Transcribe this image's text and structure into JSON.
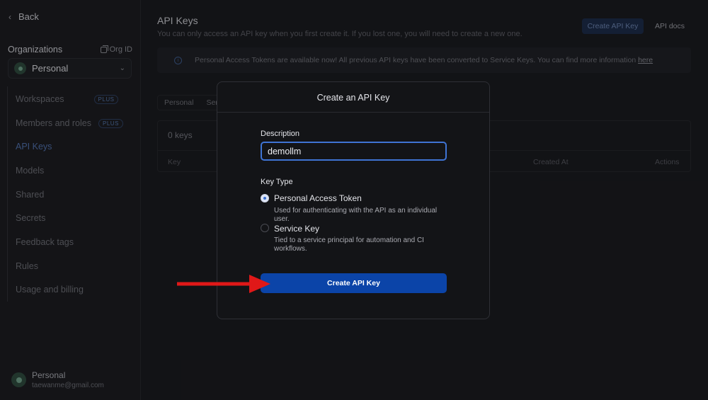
{
  "sidebar": {
    "back_label": "Back",
    "org_label": "Organizations",
    "org_id_label": "Org ID",
    "org_selected": "Personal",
    "items": [
      {
        "label": "Workspaces",
        "badge": "PLUS"
      },
      {
        "label": "Members and roles",
        "badge": "PLUS"
      },
      {
        "label": "API Keys",
        "badge": ""
      },
      {
        "label": "Models",
        "badge": ""
      },
      {
        "label": "Shared",
        "badge": ""
      },
      {
        "label": "Secrets",
        "badge": ""
      },
      {
        "label": "Feedback tags",
        "badge": ""
      },
      {
        "label": "Rules",
        "badge": ""
      },
      {
        "label": "Usage and billing",
        "badge": ""
      }
    ],
    "user": {
      "name": "Personal",
      "email": "taewanme@gmail.com"
    }
  },
  "main": {
    "title": "API Keys",
    "subtitle": "You can only access an API key when you first create it. If you lost one, you will need to create a new one.",
    "create_button": "Create API Key",
    "docs_button": "API docs",
    "banner_text": "Personal Access Tokens are available now! All previous API keys have been converted to Service Keys. You can find more information",
    "banner_link": "here",
    "tabs": [
      "Personal",
      "Serv"
    ],
    "key_count": "0 keys",
    "columns": {
      "key": "Key",
      "created_at": "Created At",
      "actions": "Actions"
    }
  },
  "modal": {
    "title": "Create an API Key",
    "description_label": "Description",
    "description_value": "demollm",
    "key_type_label": "Key Type",
    "options": [
      {
        "title": "Personal Access Token",
        "desc": "Used for authenticating with the API as an individual user.",
        "selected": true
      },
      {
        "title": "Service Key",
        "desc": "Tied to a service principal for automation and CI workflows.",
        "selected": false
      }
    ],
    "submit_label": "Create API Key"
  },
  "colors": {
    "accent": "#0b44a8",
    "focus": "#3f74d4",
    "arrow": "#e01818"
  }
}
